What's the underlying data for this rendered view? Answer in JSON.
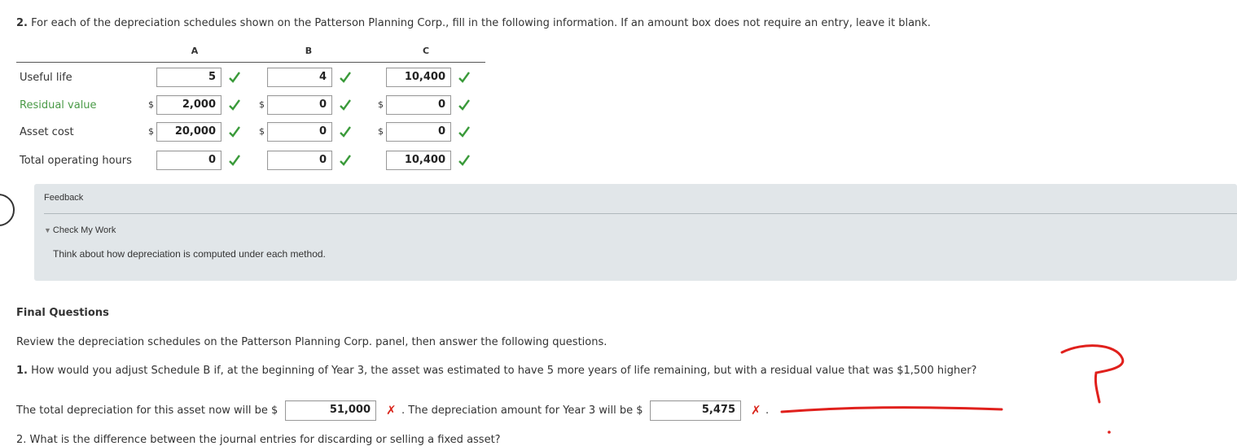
{
  "question2": {
    "number": "2.",
    "text": "For each of the depreciation schedules shown on the Patterson Planning Corp., fill in the following information. If an amount box does not require an entry, leave it blank."
  },
  "columns": [
    "A",
    "B",
    "C"
  ],
  "currency_symbol": "$",
  "rows": [
    {
      "label": "Useful life",
      "values": [
        "5",
        "4",
        "10,400"
      ],
      "has_dollar": false,
      "label_color": "#333333"
    },
    {
      "label": "Residual value",
      "values": [
        "2,000",
        "0",
        "0"
      ],
      "has_dollar": true,
      "label_color": "#4a9a47"
    },
    {
      "label": "Asset cost",
      "values": [
        "20,000",
        "0",
        "0"
      ],
      "has_dollar": true,
      "label_color": "#333333"
    },
    {
      "label": "Total operating hours",
      "values": [
        "0",
        "0",
        "10,400"
      ],
      "has_dollar": false,
      "label_color": "#333333"
    }
  ],
  "feedback": {
    "title": "Feedback",
    "toggle_label": "Check My Work",
    "text": "Think about how depreciation is computed under each method."
  },
  "final": {
    "title": "Final Questions",
    "review_text": "Review the depreciation schedules on the Patterson Planning Corp. panel, then answer the following questions.",
    "q1_number": "1.",
    "q1_text": "How would you adjust Schedule B if, at the beginning of Year 3, the asset was estimated to have 5 more years of life remaining, but with a residual value that was $1,500 higher?",
    "answer_prefix": "The total depreciation for this asset now will be $",
    "answer1_value": "51,000",
    "answer_middle": ". The depreciation amount for Year 3 will be $",
    "answer2_value": "5,475",
    "answer_suffix": ".",
    "q2_partial": "2. What is the difference between the journal entries for discarding or selling a fixed asset?"
  },
  "colors": {
    "check": "#3a9a3a",
    "wrong": "#d9261c",
    "annotation": "#e0201c",
    "feedback_bg": "#e1e6e9"
  },
  "icons": {
    "correct": "checkmark-icon",
    "incorrect": "x-mark-icon",
    "collapse": "triangle-down-icon"
  },
  "annotations": {
    "question_mark": "?"
  }
}
